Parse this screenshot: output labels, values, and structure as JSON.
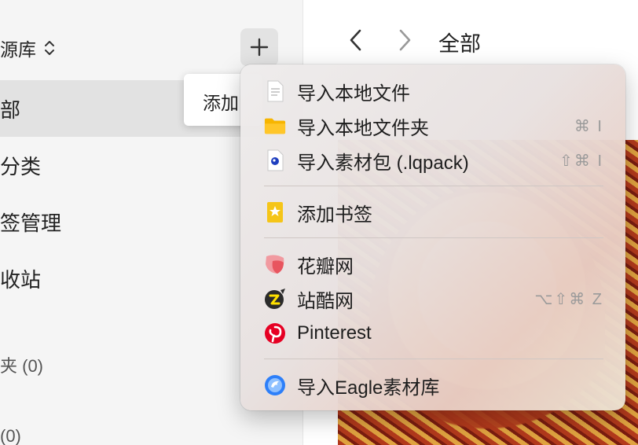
{
  "sidebar": {
    "library_title": "源库",
    "items": [
      {
        "label": "部"
      },
      {
        "label": "分类"
      },
      {
        "label": "签管理"
      },
      {
        "label": "收站"
      }
    ],
    "folders_label": "夹 (0)",
    "smart_folders_label": "(0)"
  },
  "tooltip": {
    "text": "添加"
  },
  "main": {
    "title": "全部"
  },
  "menu": {
    "items": [
      {
        "label": "导入本地文件",
        "icon": "document-icon",
        "shortcut": ""
      },
      {
        "label": "导入本地文件夹",
        "icon": "folder-icon",
        "shortcut": "⌘ I"
      },
      {
        "label": "导入素材包 (.lqpack)",
        "icon": "package-file-icon",
        "shortcut": "⇧⌘ I"
      },
      {
        "label": "添加书签",
        "icon": "bookmark-icon",
        "shortcut": ""
      },
      {
        "label": "花瓣网",
        "icon": "huaban-icon",
        "shortcut": ""
      },
      {
        "label": "站酷网",
        "icon": "zcool-icon",
        "shortcut": "⌥⇧⌘ Z"
      },
      {
        "label": "Pinterest",
        "icon": "pinterest-icon",
        "shortcut": ""
      },
      {
        "label": "导入Eagle素材库",
        "icon": "eagle-icon",
        "shortcut": ""
      }
    ]
  },
  "colors": {
    "folder": "#f7b500",
    "bookmark": "#f5c518",
    "huaban": "#e8555f",
    "pinterest": "#e60023",
    "eagle": "#2d7ff9"
  }
}
